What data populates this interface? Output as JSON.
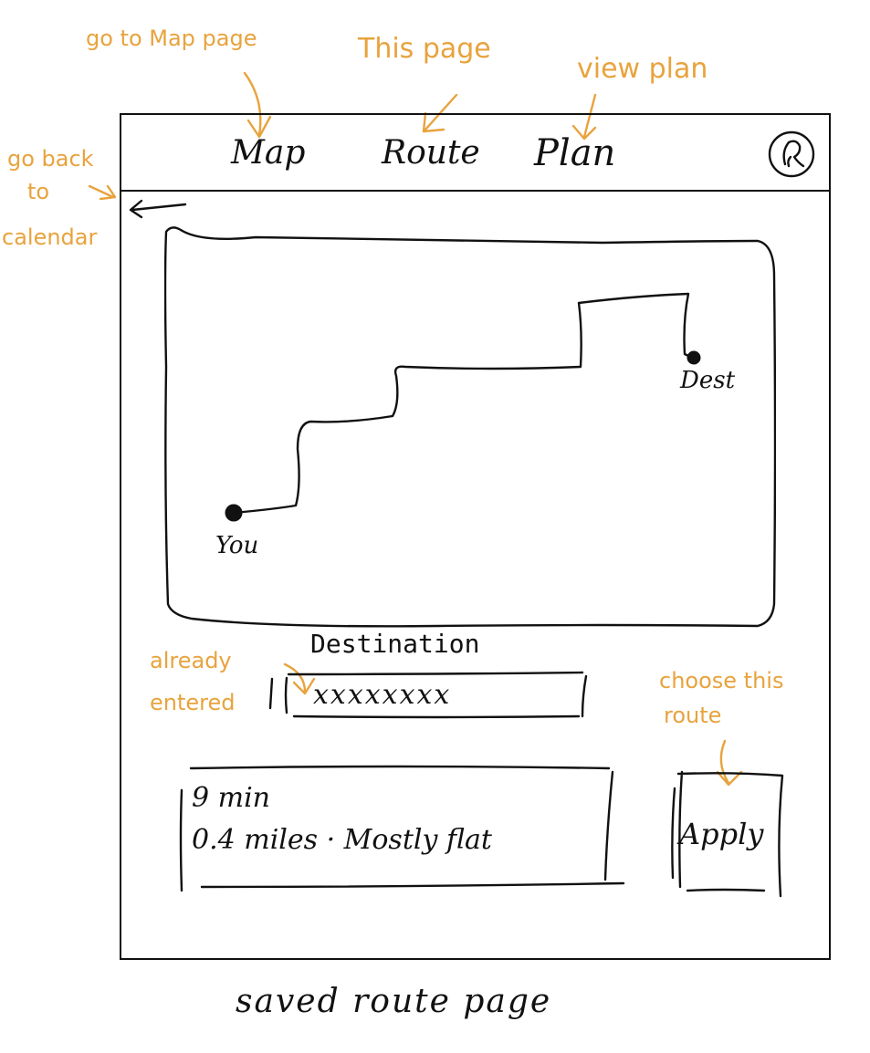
{
  "nav": {
    "tabs": [
      {
        "label": "Map"
      },
      {
        "label": "Route"
      },
      {
        "label": "Plan"
      }
    ]
  },
  "annotations": {
    "map_tab": "go to Map page",
    "route_tab": "This page",
    "plan_tab": "view plan",
    "back_line1": "go back",
    "back_line2": "to",
    "back_line3": "calendar",
    "dest_line1": "already",
    "dest_line2": "entered",
    "apply_line1": "choose this",
    "apply_line2": "route"
  },
  "map": {
    "start_label": "You",
    "end_label": "Dest"
  },
  "destination": {
    "title": "Destination",
    "value": "xxxxxxxx"
  },
  "route": {
    "time": "9 min",
    "details": "0.4 miles · Mostly flat"
  },
  "apply_label": "Apply",
  "caption": "saved route page",
  "colors": {
    "annotation": "#E8A33D",
    "ink": "#111111"
  },
  "icons": {
    "back": "arrow-left-icon",
    "profile": "user-avatar-icon"
  }
}
